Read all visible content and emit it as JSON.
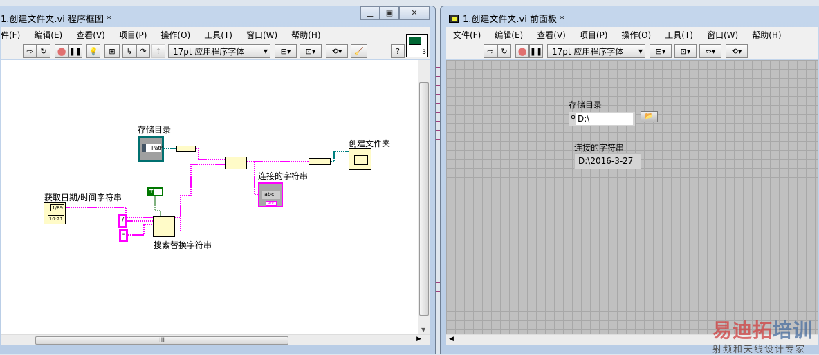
{
  "diagram_window": {
    "title": "1.创建文件夹.vi 程序框图 *",
    "menu": [
      "件(F)",
      "编辑(E)",
      "查看(V)",
      "项目(P)",
      "操作(O)",
      "工具(T)",
      "窗口(W)",
      "帮助(H)"
    ],
    "font_select": "17pt 应用程序字体",
    "help_label": "?",
    "connector_number": "3",
    "scroll_grip": "III",
    "nodes": {
      "path_control_label": "存储目录",
      "path_text": "Path",
      "create_folder_label": "创建文件夹",
      "concat_indicator_label": "连接的字符串",
      "indicator_text": "abc",
      "indicator_type": "abc",
      "datetime_label": "获取日期/时间字符串",
      "datetime_date": "1/89",
      "datetime_time": "10:21",
      "search_replace_label": "搜索替换字符串",
      "bool_const": "T",
      "const_slash": "/",
      "const_dash": "-"
    }
  },
  "panel_window": {
    "title": "1.创建文件夹.vi 前面板 *",
    "menu": [
      "文件(F)",
      "编辑(E)",
      "查看(V)",
      "项目(P)",
      "操作(O)",
      "工具(T)",
      "窗口(W)",
      "帮助(H)"
    ],
    "font_select": "17pt 应用程序字体",
    "path_label": "存储目录",
    "path_value": "D:\\",
    "string_label": "连接的字符串",
    "string_value": "D:\\2016-3-27"
  },
  "watermark": {
    "brand": "易迪拓培训",
    "slogan": "射频和天线设计专家"
  },
  "colors": {
    "string_wire": "#ff00ff",
    "path_wire": "#008080",
    "bool_wire": "#006600"
  }
}
